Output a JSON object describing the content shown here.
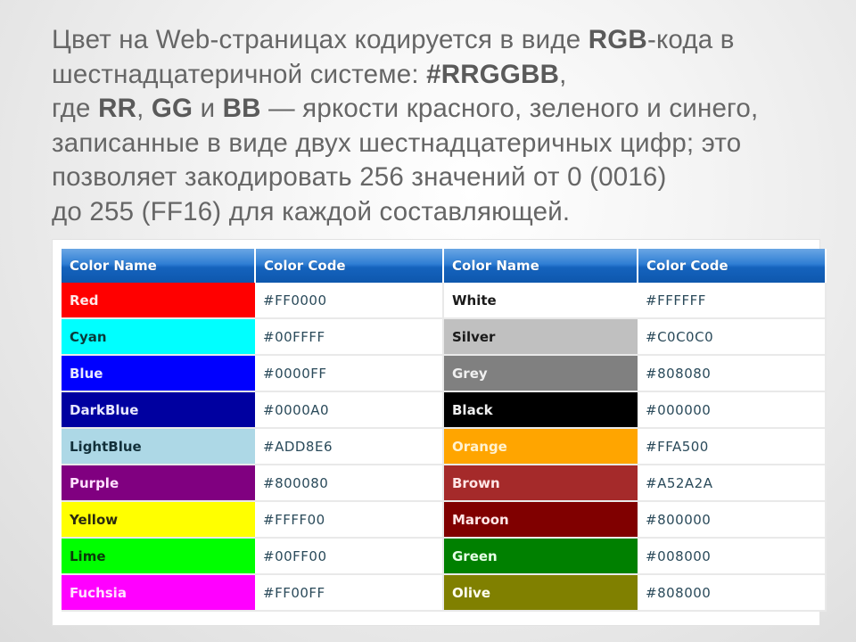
{
  "intro": {
    "line1_a": "Цвет на Web-страницах кодируется в виде ",
    "line1_b": "RGB",
    "line1_c": "-кода в",
    "line2_a": "шестнадцатеричной системе: ",
    "line2_b": "#RRGGBB",
    "line2_c": ",",
    "line3_a": "где ",
    "line3_b": "RR",
    "line3_c": ", ",
    "line3_d": "GG",
    "line3_e": " и ",
    "line3_f": "BB",
    "line3_g": " — яркости красного, зеленого и синего,",
    "line4": "записанные в виде двух шестнадцатеричных цифр; это",
    "line5": "позволяет закодировать 256 значений от 0 (0016)",
    "line6": "до 255 (FF16) для каждой составляющей."
  },
  "table": {
    "headers": [
      "Color Name",
      "Color Code",
      "Color Name",
      "Color Code"
    ],
    "rows": [
      {
        "left": {
          "name": "Red",
          "code": "#FF0000",
          "bg": "#FF0000",
          "fg": "#ffe8e8"
        },
        "right": {
          "name": "White",
          "code": "#FFFFFF",
          "bg": "#FFFFFF",
          "fg": "#1a1a1a"
        }
      },
      {
        "left": {
          "name": "Cyan",
          "code": "#00FFFF",
          "bg": "#00FFFF",
          "fg": "#0a3a3a"
        },
        "right": {
          "name": "Silver",
          "code": "#C0C0C0",
          "bg": "#C0C0C0",
          "fg": "#1a1a1a"
        }
      },
      {
        "left": {
          "name": "Blue",
          "code": "#0000FF",
          "bg": "#0000FF",
          "fg": "#e8e8ff"
        },
        "right": {
          "name": "Grey",
          "code": "#808080",
          "bg": "#808080",
          "fg": "#f0f0f0"
        }
      },
      {
        "left": {
          "name": "DarkBlue",
          "code": "#0000A0",
          "bg": "#0000A0",
          "fg": "#e8e8ff"
        },
        "right": {
          "name": "Black",
          "code": "#000000",
          "bg": "#000000",
          "fg": "#f0f0f0"
        }
      },
      {
        "left": {
          "name": "LightBlue",
          "code": "#ADD8E6",
          "bg": "#ADD8E6",
          "fg": "#12303a"
        },
        "right": {
          "name": "Orange",
          "code": "#FFA500",
          "bg": "#FFA500",
          "fg": "#fff2d0"
        }
      },
      {
        "left": {
          "name": "Purple",
          "code": "#800080",
          "bg": "#800080",
          "fg": "#ffe0ff"
        },
        "right": {
          "name": "Brown",
          "code": "#A52A2A",
          "bg": "#A52A2A",
          "fg": "#ffe6e6"
        }
      },
      {
        "left": {
          "name": "Yellow",
          "code": "#FFFF00",
          "bg": "#FFFF00",
          "fg": "#2a2a10"
        },
        "right": {
          "name": "Maroon",
          "code": "#800000",
          "bg": "#800000",
          "fg": "#ffe6e6"
        }
      },
      {
        "left": {
          "name": "Lime",
          "code": "#00FF00",
          "bg": "#00FF00",
          "fg": "#0a3a0a"
        },
        "right": {
          "name": "Green",
          "code": "#008000",
          "bg": "#008000",
          "fg": "#e6ffe6"
        }
      },
      {
        "left": {
          "name": "Fuchsia",
          "code": "#FF00FF",
          "bg": "#FF00FF",
          "fg": "#ffe0ff"
        },
        "right": {
          "name": "Olive",
          "code": "#808000",
          "bg": "#808000",
          "fg": "#fffff0"
        }
      }
    ]
  }
}
